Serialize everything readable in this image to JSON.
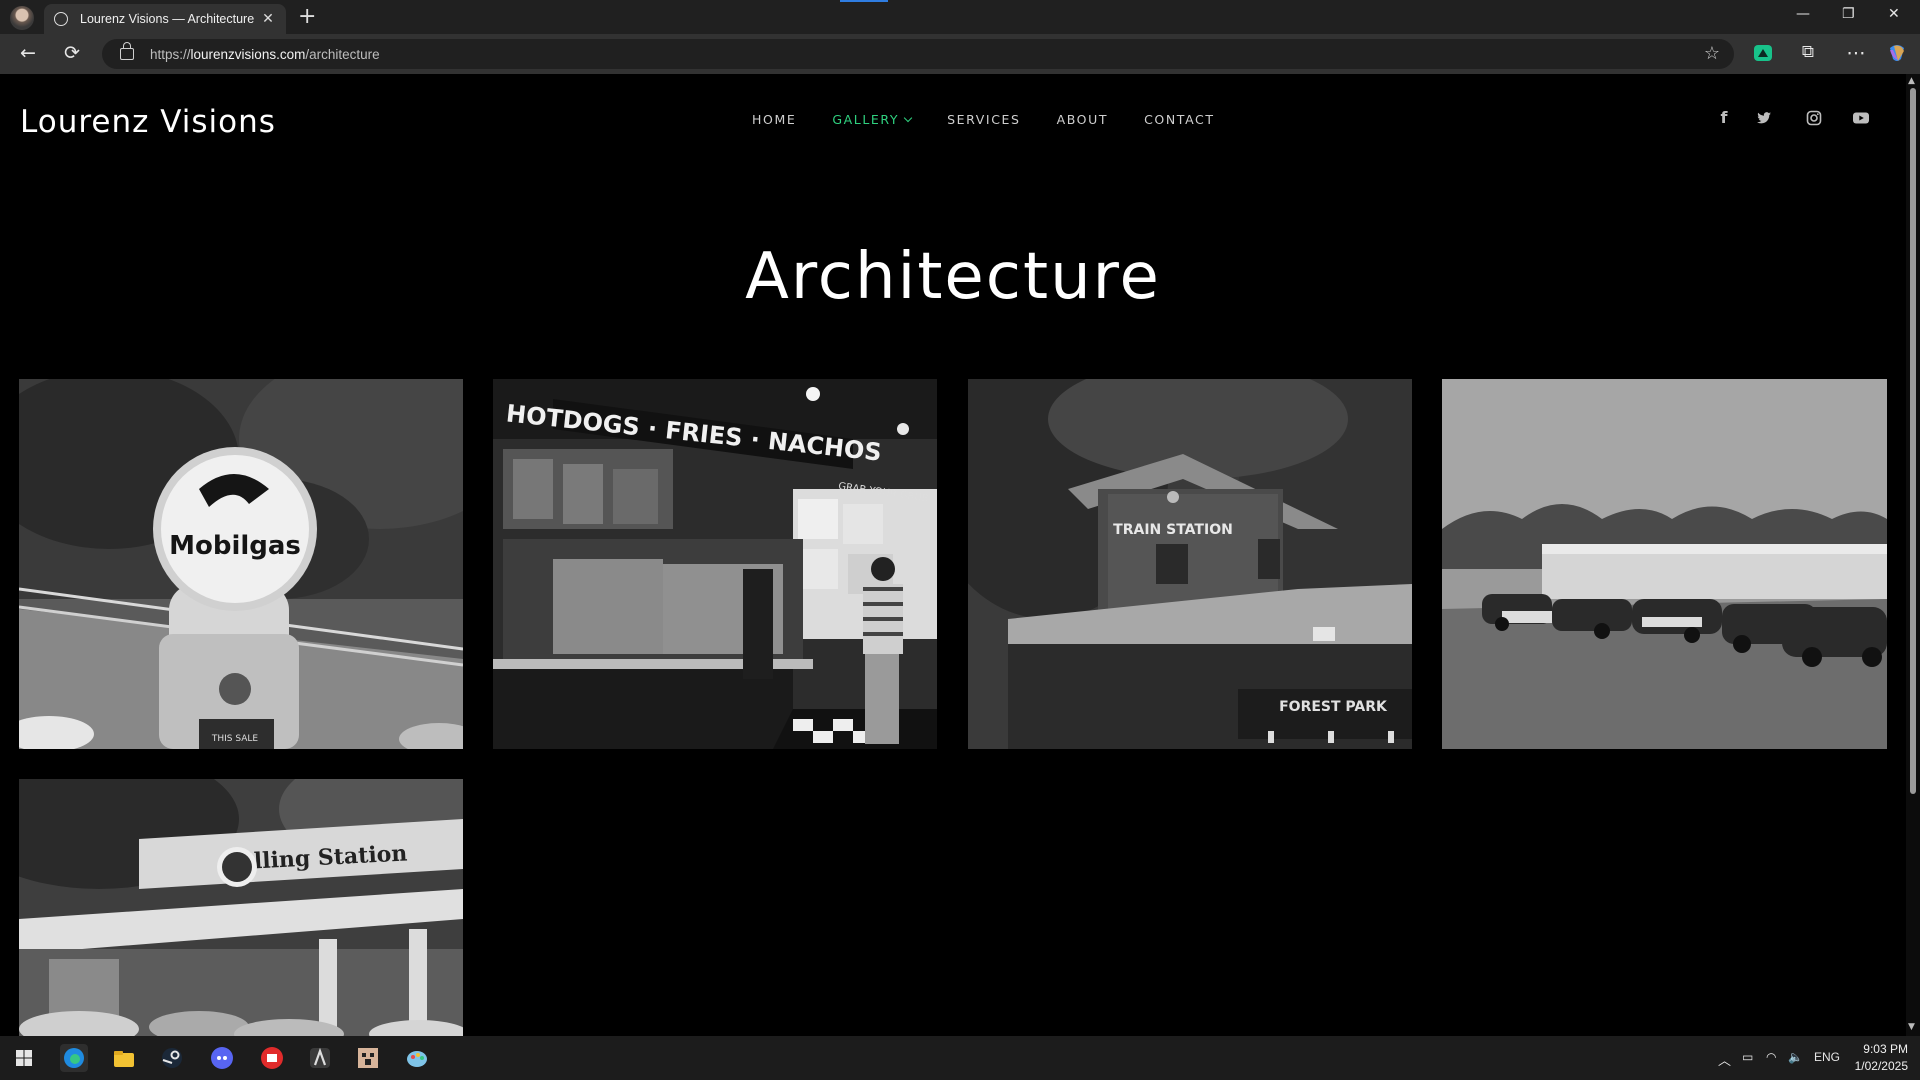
{
  "browser": {
    "tab_title": "Lourenz Visions — Architecture",
    "tab_close": "✕",
    "new_tab": "+",
    "url_prefix": "https://",
    "url_host": "lourenzvisions.com",
    "url_path": "/architecture",
    "window_minimize": "—",
    "window_restore": "❐",
    "window_close": "✕",
    "back": "←",
    "reload": "⟳",
    "favorite": "☆",
    "extensions": "⧉",
    "more": "⋯"
  },
  "site": {
    "logo": "Lourenz Visions",
    "nav": [
      {
        "label": "HOME"
      },
      {
        "label": "GALLERY"
      },
      {
        "label": "SERVICES"
      },
      {
        "label": "ABOUT"
      },
      {
        "label": "CONTACT"
      }
    ],
    "active_nav": "GALLERY",
    "social": [
      {
        "icon": "facebook-icon",
        "glyph": "f"
      },
      {
        "icon": "twitter-icon",
        "glyph": "🐦"
      },
      {
        "icon": "instagram-icon",
        "glyph": "◎"
      },
      {
        "icon": "youtube-icon",
        "glyph": "▶"
      }
    ],
    "page_heading": "Architecture",
    "gallery": [
      {
        "subject": "mobilgas-pump",
        "sign": "Mobilgas",
        "small_text": "THIS SALE"
      },
      {
        "subject": "hotdog-stand",
        "sign": "HOTDOGS · FRIES · NACHOS",
        "small_text": "GRAB YOUR GRUB"
      },
      {
        "subject": "train-station",
        "sign": "TRAIN STATION",
        "small_text": "FOREST PARK"
      },
      {
        "subject": "vintage-cars-lot",
        "sign": "",
        "small_text": ""
      },
      {
        "subject": "filling-station",
        "sign": "Filling Station",
        "small_text": ""
      }
    ]
  },
  "taskbar": {
    "language": "ENG",
    "time": "9:03 PM",
    "date": "1/02/2025"
  },
  "colors": {
    "accent_green": "#2fd17f",
    "page_bg": "#000000",
    "chrome_bg": "#202020"
  }
}
